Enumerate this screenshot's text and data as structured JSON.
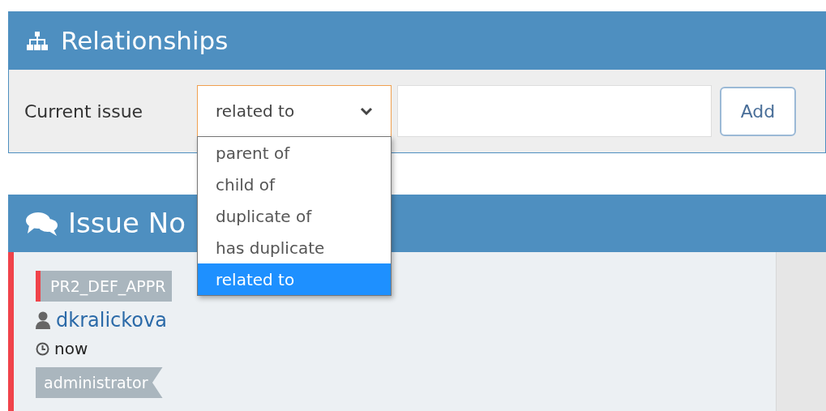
{
  "relationships": {
    "title": "Relationships",
    "label": "Current issue",
    "select": {
      "value": "related to",
      "expanded": true,
      "options": [
        {
          "label": "parent of",
          "selected": false
        },
        {
          "label": "child of",
          "selected": false
        },
        {
          "label": "duplicate of",
          "selected": false
        },
        {
          "label": "has duplicate",
          "selected": false
        },
        {
          "label": "related to",
          "selected": true
        }
      ]
    },
    "add_button": "Add"
  },
  "issue_notes": {
    "title": "Issue No",
    "note": {
      "status_tag": "PR2_DEF_APPR",
      "user": "dkralickova",
      "time": "now",
      "role_tag": "administrator"
    }
  }
}
